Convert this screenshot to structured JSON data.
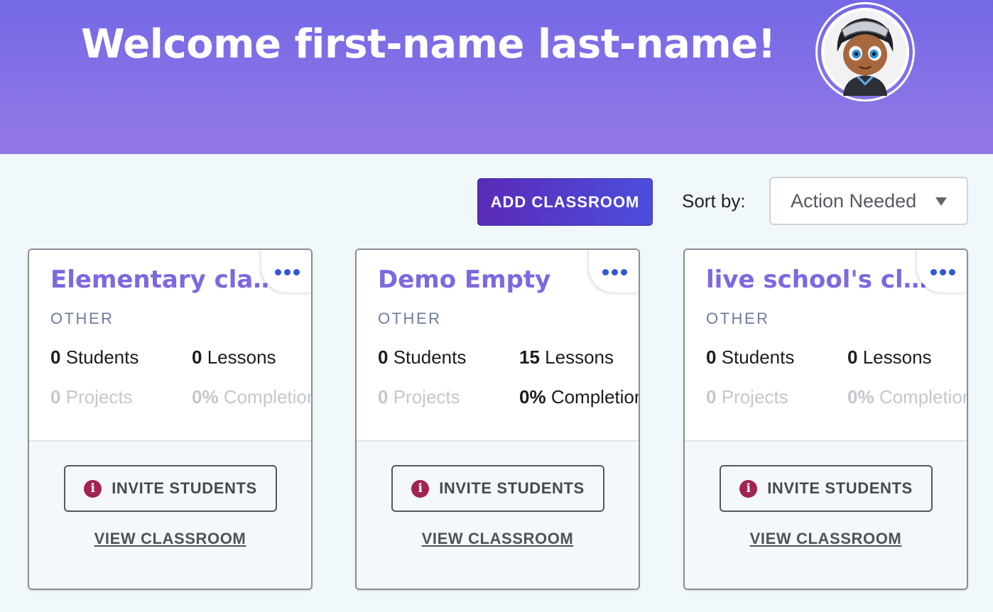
{
  "header": {
    "welcome": "Welcome first-name last-name!",
    "avatar_icon": "user-avatar"
  },
  "toolbar": {
    "add_classroom_label": "ADD CLASSROOM",
    "sort_label": "Sort by:",
    "sort_value": "Action Needed"
  },
  "colors": {
    "header_top": "#7468e6",
    "header_bottom": "#9479e6",
    "accent_title": "#7d68e0",
    "menu_dots": "#2f58d6",
    "info_icon": "#a3234f"
  },
  "classrooms": [
    {
      "title": "Elementary class...",
      "category": "OTHER",
      "students_count": "0",
      "students_label": "Students",
      "lessons_count": "0",
      "lessons_label": "Lessons",
      "projects_count": "0",
      "projects_label": "Projects",
      "completion_pct": "0%",
      "completion_label": "Completion",
      "invite_label": "INVITE STUDENTS",
      "view_label": "VIEW CLASSROOM"
    },
    {
      "title": "Demo Empty",
      "category": "OTHER",
      "students_count": "0",
      "students_label": "Students",
      "lessons_count": "15",
      "lessons_label": "Lessons",
      "projects_count": "0",
      "projects_label": "Projects",
      "completion_pct": "0%",
      "completion_label": "Completion",
      "invite_label": "INVITE STUDENTS",
      "view_label": "VIEW CLASSROOM"
    },
    {
      "title": "live school's class...",
      "category": "OTHER",
      "students_count": "0",
      "students_label": "Students",
      "lessons_count": "0",
      "lessons_label": "Lessons",
      "projects_count": "0",
      "projects_label": "Projects",
      "completion_pct": "0%",
      "completion_label": "Completion",
      "invite_label": "INVITE STUDENTS",
      "view_label": "VIEW CLASSROOM"
    }
  ]
}
